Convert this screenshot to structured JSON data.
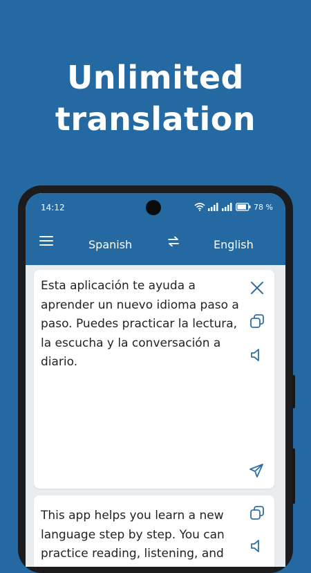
{
  "promo": {
    "title_line1": "Unlimited",
    "title_line2": "translation"
  },
  "status_bar": {
    "time": "14:12",
    "battery": "78 %"
  },
  "toolbar": {
    "source_language": "Spanish",
    "target_language": "English"
  },
  "source_card": {
    "text": "Esta aplicación te ayuda a aprender un nuevo idioma paso a paso. Puedes practicar la lectura, la escucha y la conversación a diario."
  },
  "result_card": {
    "text": "This app helps you learn a new language step by step. You can practice reading, listening, and"
  },
  "icons": {
    "menu": "menu-icon",
    "swap": "swap-languages-icon",
    "clear": "close-icon",
    "copy": "copy-icon",
    "speak": "speaker-icon",
    "send": "send-icon"
  },
  "colors": {
    "brand_blue": "#2469a1",
    "icon_blue": "#2f6ea5",
    "text": "#222222"
  }
}
